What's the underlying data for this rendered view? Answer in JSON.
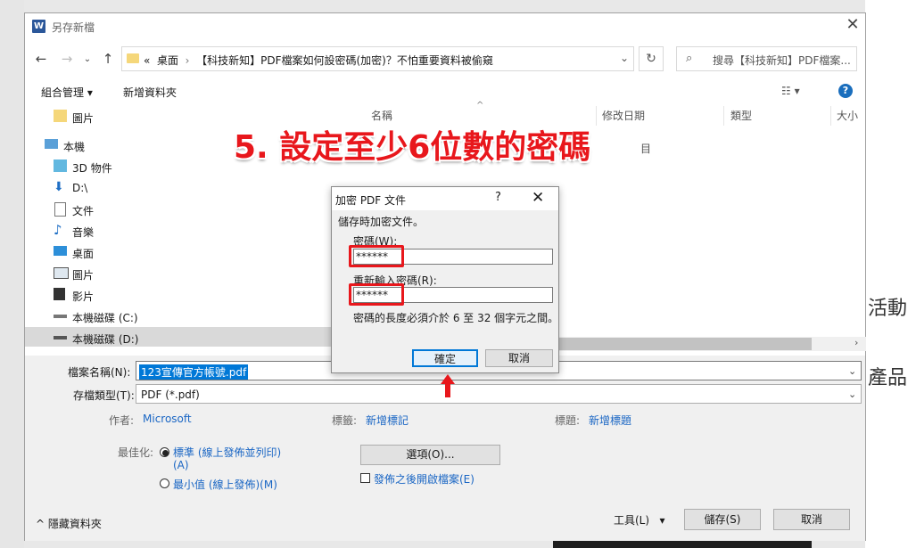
{
  "background": {
    "doc_text_1": "活動",
    "doc_text_2": "產品"
  },
  "window": {
    "title": "另存新檔",
    "title_icon": "W",
    "close_glyph": "✕"
  },
  "address_bar": {
    "prefix": "«",
    "path": [
      "桌面",
      "【科技新知】PDF檔案如何設密碼(加密)？不怕重要資料被偷窺"
    ],
    "separator": "›",
    "search_placeholder": "搜尋【科技新知】PDF檔案..."
  },
  "toolbar": {
    "organize": "組合管理 ▾",
    "new_folder": "新增資料夾",
    "view_glyph": "☷ ▾",
    "help": "?"
  },
  "nav_items": [
    {
      "label": "圖片",
      "icon": "folder-icon"
    },
    {
      "label": "本機",
      "icon": "computer-icon"
    },
    {
      "label": "3D 物件",
      "icon": "cube-icon"
    },
    {
      "label": "D:\\",
      "icon": "download-icon"
    },
    {
      "label": "文件",
      "icon": "document-icon"
    },
    {
      "label": "音樂",
      "icon": "music-icon"
    },
    {
      "label": "桌面",
      "icon": "desktop-icon"
    },
    {
      "label": "圖片",
      "icon": "picture-icon"
    },
    {
      "label": "影片",
      "icon": "film-icon"
    },
    {
      "label": "本機磁碟 (C:)",
      "icon": "drive-icon"
    },
    {
      "label": "本機磁碟 (D:)",
      "icon": "drive-icon"
    }
  ],
  "file_list": {
    "col_name": "名稱",
    "col_date": "修改日期",
    "col_type": "類型",
    "col_size": "大小",
    "empty_message": "目"
  },
  "form": {
    "filename_label": "檔案名稱(N):",
    "filename_value": "123宣傳官方帳號.pdf",
    "filetype_label": "存檔類型(T):",
    "filetype_value": "PDF (*.pdf)",
    "author_label": "作者:",
    "author_value": "Microsoft",
    "tags_label": "標籤:",
    "tags_value": "新增標記",
    "title_label": "標題:",
    "title_value": "新增標題",
    "optimize_label": "最佳化:",
    "opt_standard_1": "標準 (線上發佈並列印)",
    "opt_standard_2": "(A)",
    "opt_minimum": "最小值 (線上發佈)(M)",
    "options_button": "選項(O)...",
    "open_after": "發佈之後開啟檔案(E)",
    "hide_folders": "隱藏資料夾",
    "tools": "工具(L)",
    "save": "儲存(S)",
    "cancel": "取消"
  },
  "annotation": {
    "text": "5. 設定至少6位數的密碼"
  },
  "dialog": {
    "title": "加密 PDF 文件",
    "help": "?",
    "close": "✕",
    "description": "儲存時加密文件。",
    "password_label": "密碼(W):",
    "password_value": "******",
    "reenter_label": "重新輸入密碼(R):",
    "reenter_value": "******",
    "hint": "密碼的長度必須介於 6 至 32 個字元之間。",
    "ok": "確定",
    "cancel": "取消"
  },
  "colors": {
    "accent": "#0078d7",
    "annotation_red": "#e8171c",
    "link_blue": "#1a66c4"
  }
}
